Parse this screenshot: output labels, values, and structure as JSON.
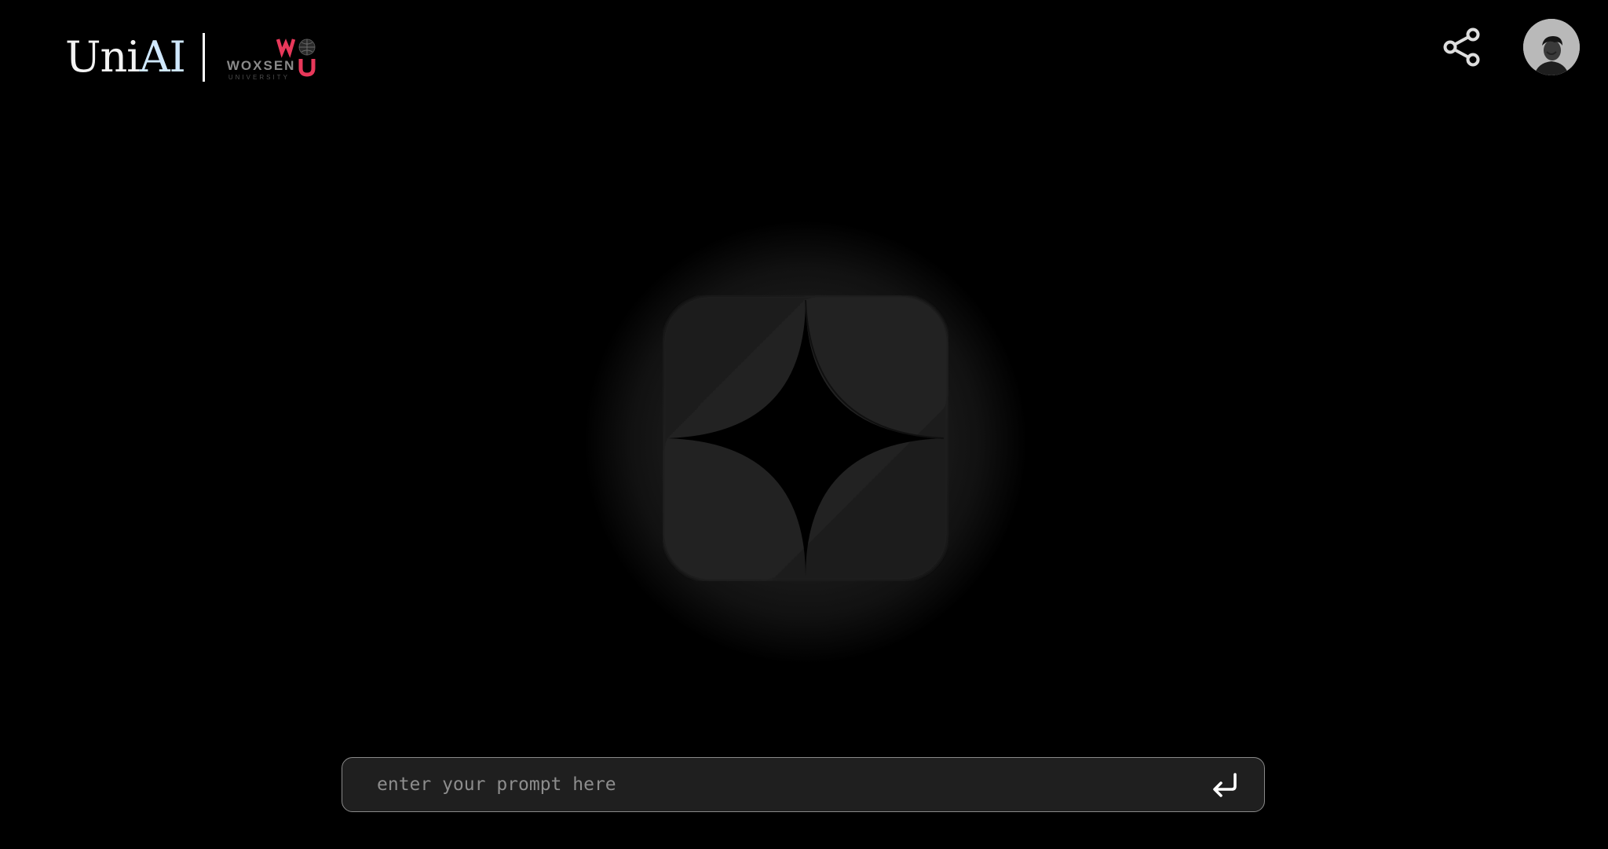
{
  "brand": {
    "name_part1": "Uni",
    "name_part2": "AI",
    "partner_name": "WOXSEN",
    "partner_subtitle": "UNIVERSITY"
  },
  "header": {
    "share_icon": "share-icon",
    "avatar_icon": "user-avatar"
  },
  "prompt": {
    "placeholder": "enter your prompt here",
    "value": "",
    "submit_icon": "enter-return-icon"
  },
  "colors": {
    "background": "#000000",
    "prompt_bg": "#1f1f1f",
    "prompt_border": "#8a8a8a",
    "brand_ai": "#cfe8ff",
    "partner_accent": "#e8385a"
  }
}
